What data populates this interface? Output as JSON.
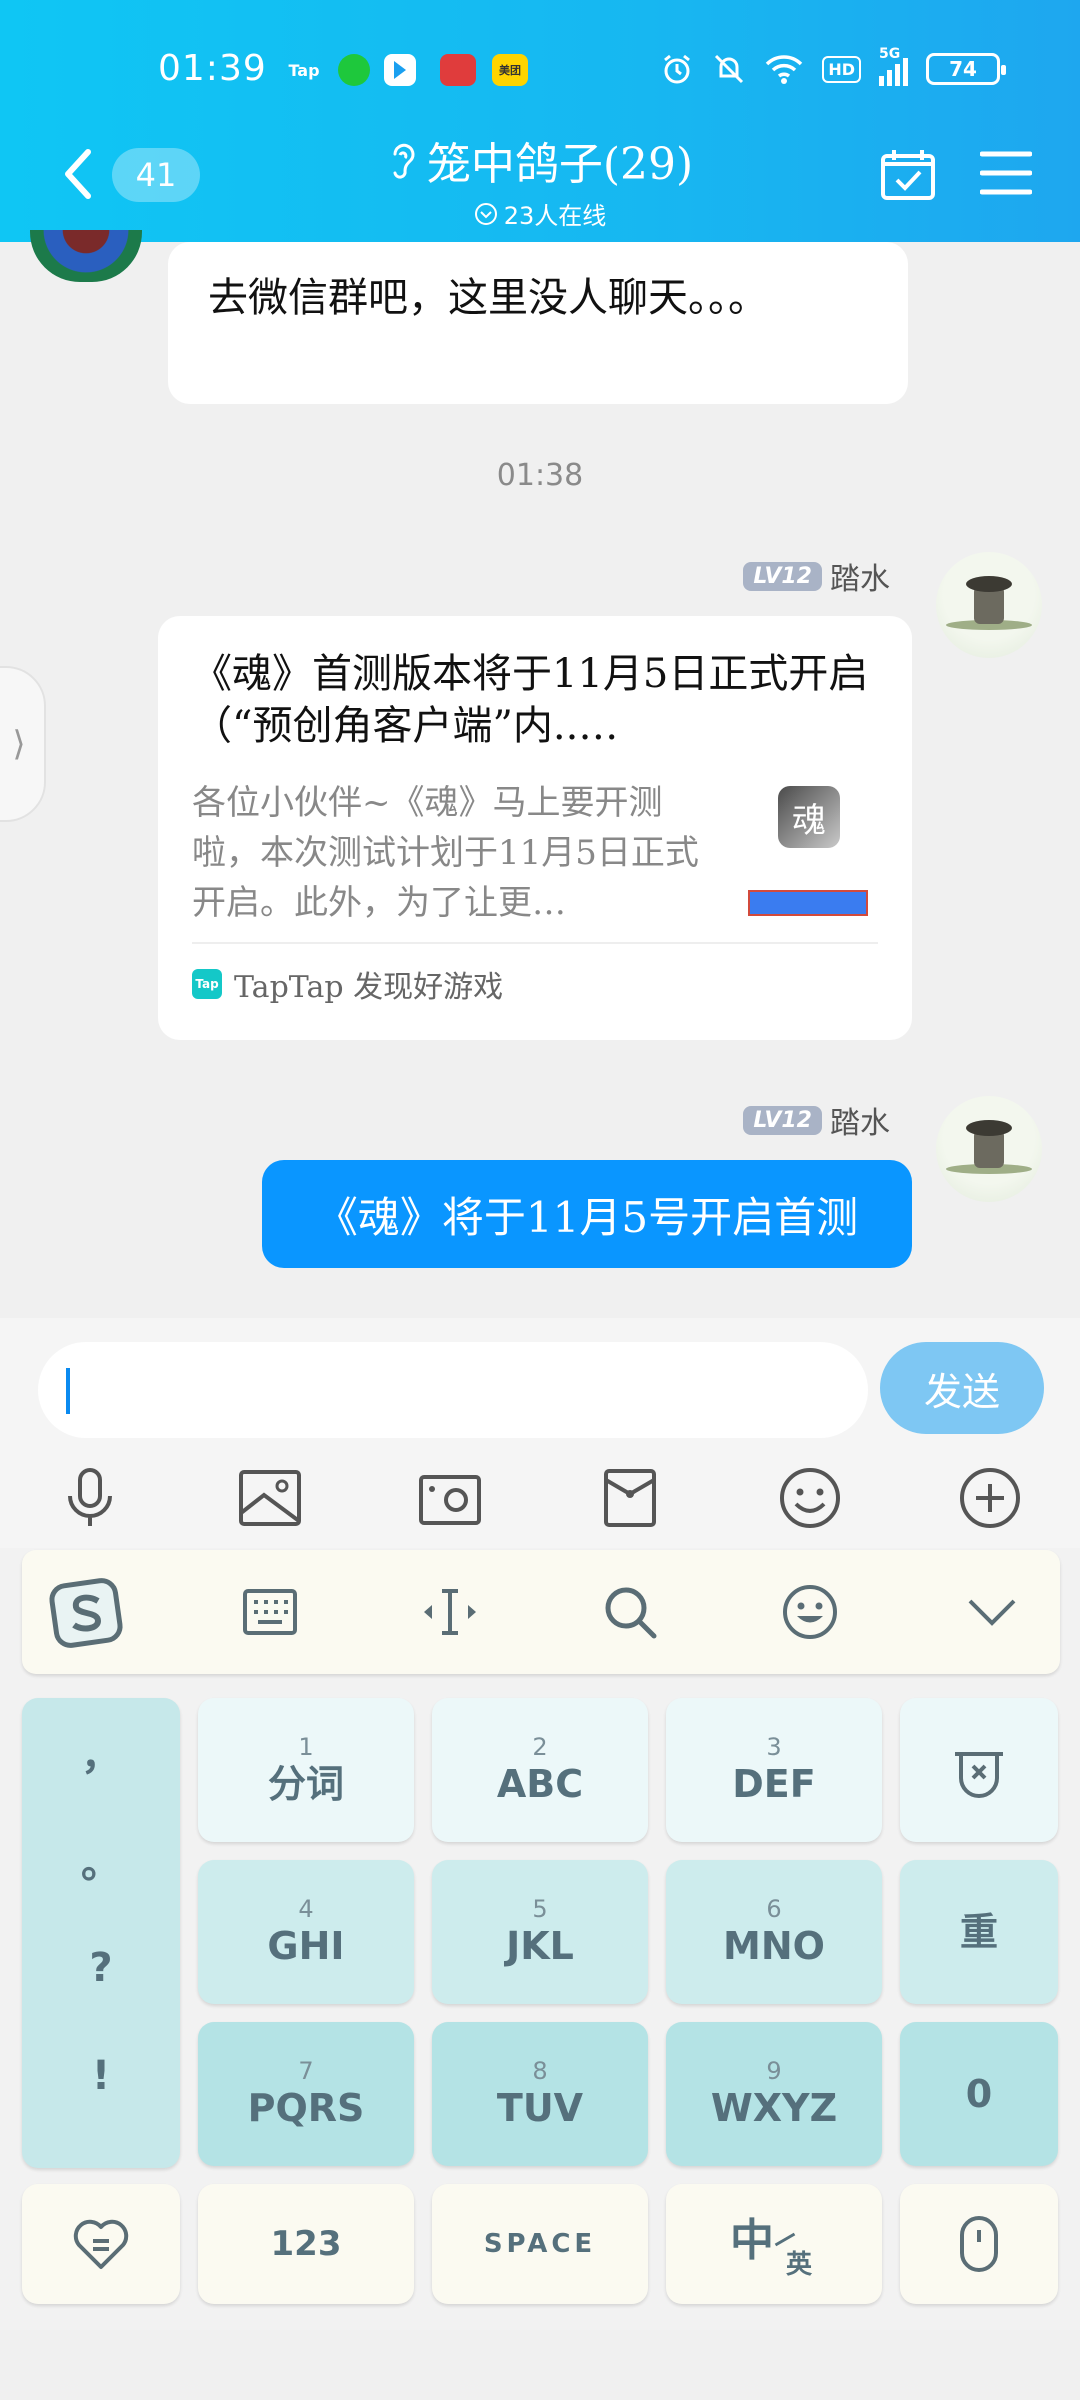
{
  "status_bar": {
    "time": "01:39",
    "apps": [
      "Tap",
      "",
      "",
      "",
      "美团"
    ],
    "network": "5G",
    "hd": "HD",
    "battery": "74"
  },
  "header": {
    "unread_count": "41",
    "title": "笼中鸽子(29)",
    "online": "23人在线"
  },
  "messages": {
    "msg1_text": "去微信群吧，这里没人聊天。。。",
    "timestamp": "01:38",
    "sender_level": "LV12",
    "sender_name": "踏水",
    "card_title": "《魂》首测版本将于11月5日正式开启（“预创角客户端”内..…",
    "card_desc": "各位小伙伴~《魂》马上要开测啦，本次测试计划于11月5日正式开启。此外，为了让更…",
    "card_thumb_logo": "魂",
    "card_source": "TapTap 发现好游戏",
    "card_badge": "Tap",
    "msg3_text": "《魂》将于11月5号开启首测"
  },
  "input": {
    "send_label": "发送"
  },
  "keyboard": {
    "punctuation": [
      "，",
      "。",
      "?",
      "!"
    ],
    "rows": [
      [
        {
          "num": "1",
          "label": "分词"
        },
        {
          "num": "2",
          "label": "ABC"
        },
        {
          "num": "3",
          "label": "DEF"
        }
      ],
      [
        {
          "num": "4",
          "label": "GHI"
        },
        {
          "num": "5",
          "label": "JKL"
        },
        {
          "num": "6",
          "label": "MNO"
        }
      ],
      [
        {
          "num": "7",
          "label": "PQRS"
        },
        {
          "num": "8",
          "label": "TUV"
        },
        {
          "num": "9",
          "label": "WXYZ"
        }
      ]
    ],
    "redo_label": "重",
    "zero_label": "0",
    "num_label": "123",
    "space_label": "SPACE",
    "lang_main": "中",
    "lang_sub": "英"
  },
  "colors": {
    "header_gradient_start": "#0fc6f4",
    "header_gradient_end": "#1ea7ef",
    "sent_bubble": "#0a96ff",
    "send_button": "#7ec7f3"
  }
}
